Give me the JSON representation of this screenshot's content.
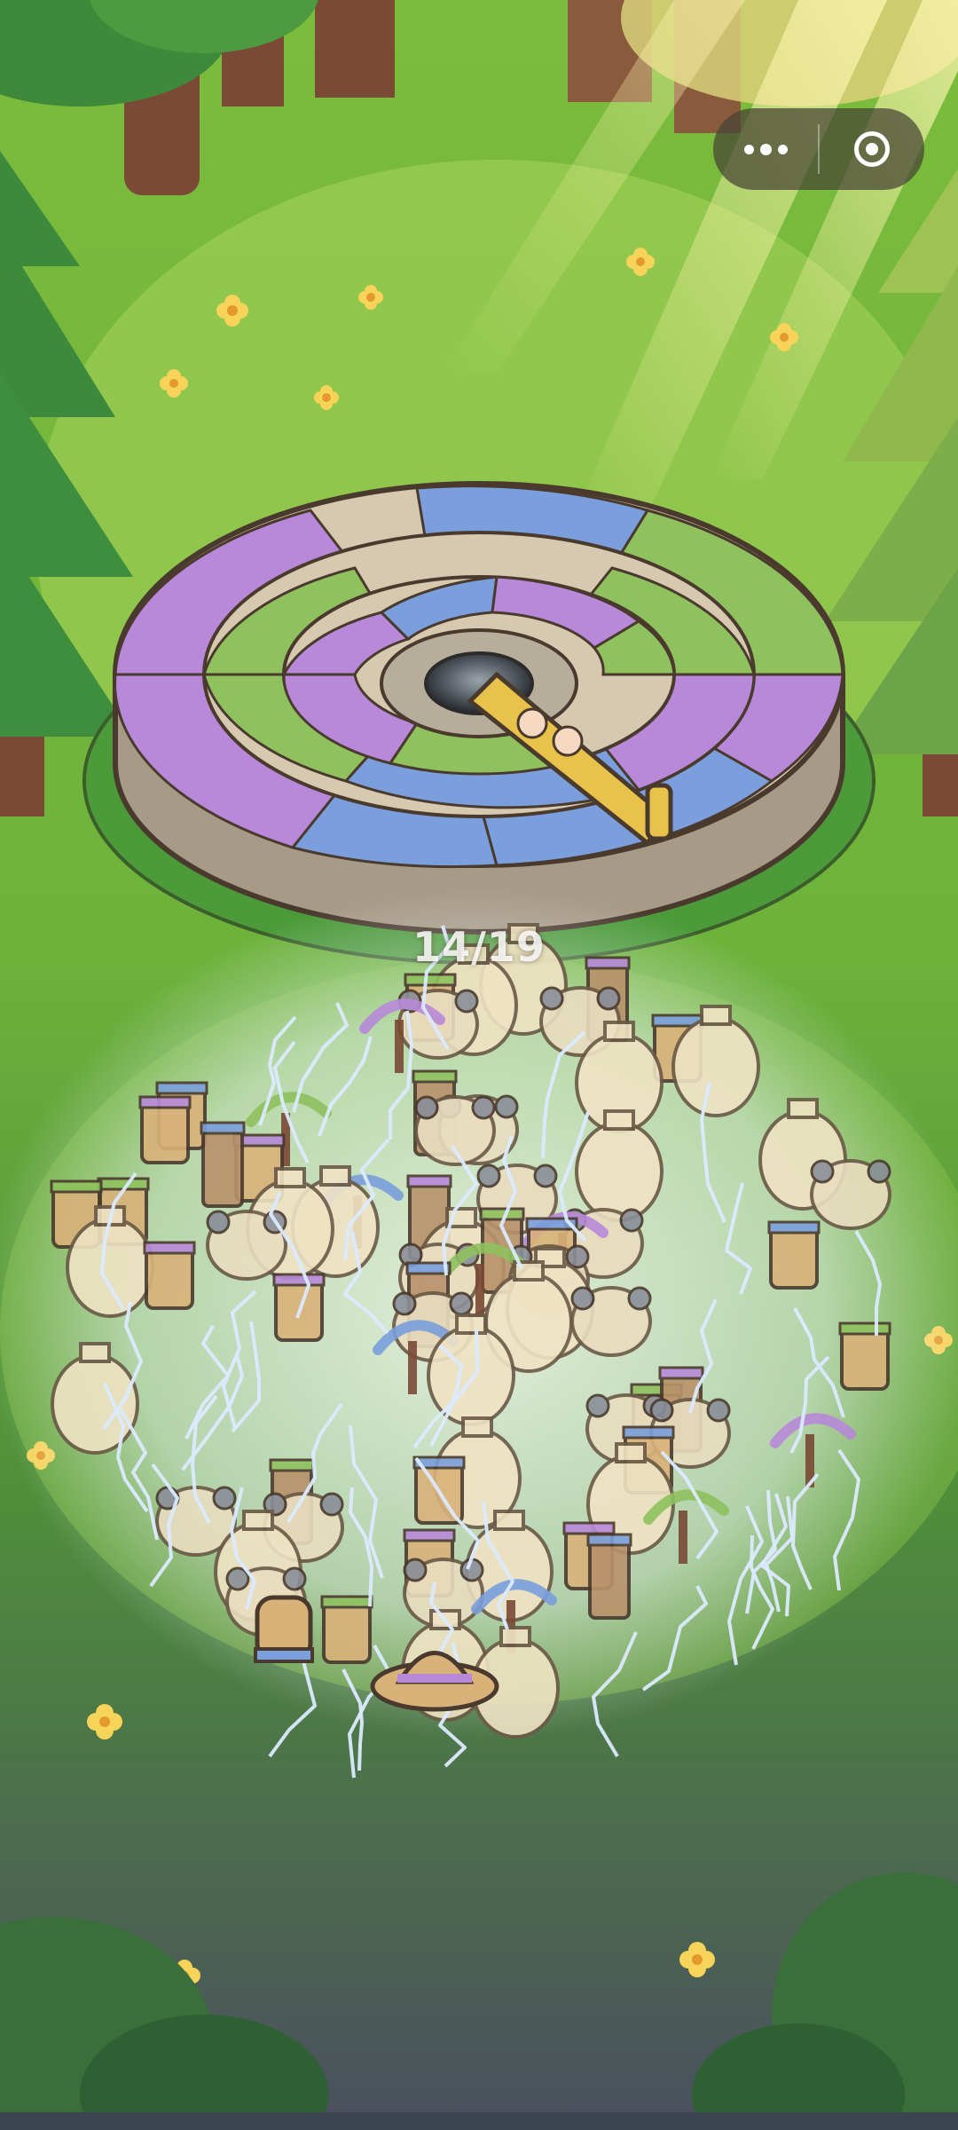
{
  "capsule": {
    "more_icon": "more-dots-icon",
    "close_icon": "target-close-icon"
  },
  "board": {
    "remaining_counter": "14/19",
    "colors": {
      "purple": "#b889d9",
      "blue": "#7a9fdc",
      "green": "#8fc15e",
      "beige": "#d9cdb5"
    }
  },
  "item_types": [
    "jar",
    "vase",
    "cup",
    "box",
    "glove",
    "hat",
    "sickle",
    "mug"
  ],
  "colors": {
    "grass": "#74b23f",
    "meadow_light": "#a8d45a",
    "bark": "#7a4a36",
    "outline": "#4a3a2e"
  }
}
